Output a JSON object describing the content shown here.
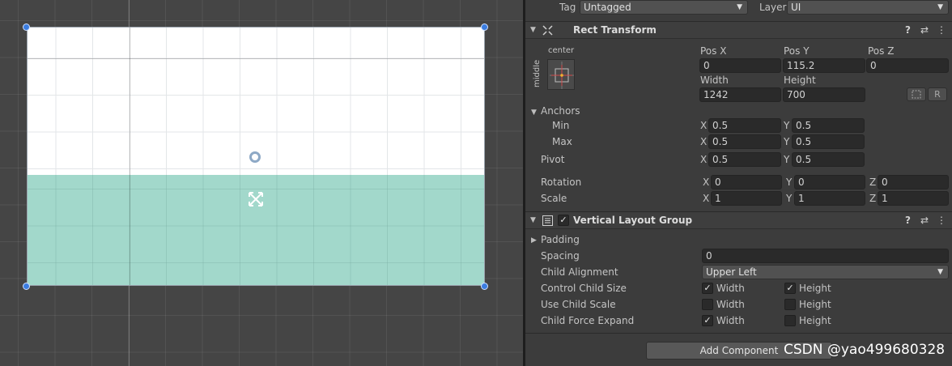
{
  "header": {
    "tag_label": "Tag",
    "tag_value": "Untagged",
    "layer_label": "Layer",
    "layer_value": "UI"
  },
  "rect_transform": {
    "title": "Rect Transform",
    "anchor_preset_h": "center",
    "anchor_preset_v": "middle",
    "pos_x_label": "Pos X",
    "pos_y_label": "Pos Y",
    "pos_z_label": "Pos Z",
    "pos_x": "0",
    "pos_y": "115.2",
    "pos_z": "0",
    "width_label": "Width",
    "height_label": "Height",
    "width": "1242",
    "height": "700",
    "raw_button": "R",
    "anchors_label": "Anchors",
    "min_label": "Min",
    "max_label": "Max",
    "min_x": "0.5",
    "min_y": "0.5",
    "max_x": "0.5",
    "max_y": "0.5",
    "pivot_label": "Pivot",
    "pivot_x": "0.5",
    "pivot_y": "0.5",
    "rotation_label": "Rotation",
    "rot_x": "0",
    "rot_y": "0",
    "rot_z": "0",
    "scale_label": "Scale",
    "scale_x": "1",
    "scale_y": "1",
    "scale_z": "1",
    "axis_x": "X",
    "axis_y": "Y",
    "axis_z": "Z"
  },
  "vlg": {
    "title": "Vertical Layout Group",
    "enabled": true,
    "padding_label": "Padding",
    "spacing_label": "Spacing",
    "spacing_value": "0",
    "child_alignment_label": "Child Alignment",
    "child_alignment_value": "Upper Left",
    "control_child_size_label": "Control Child Size",
    "use_child_scale_label": "Use Child Scale",
    "child_force_expand_label": "Child Force Expand",
    "width_label": "Width",
    "height_label": "Height",
    "control_width": true,
    "control_height": true,
    "scale_width": false,
    "scale_height": false,
    "expand_width": true,
    "expand_height": false
  },
  "footer": {
    "add_component": "Add Component",
    "watermark": "CSDN @yao499680328"
  },
  "icons": {
    "help": "?",
    "presets": "⇄",
    "menu": "⋮",
    "check": "✓",
    "dropdown_arrow": "▼",
    "foldout_open": "▼",
    "foldout_closed": "▶"
  },
  "colors": {
    "scene_bg": "#454545",
    "canvas_white": "#ffffff",
    "canvas_teal": "#a2d8cb",
    "handle_blue": "#3b7de0",
    "inspector_bg": "#3c3c3c"
  }
}
